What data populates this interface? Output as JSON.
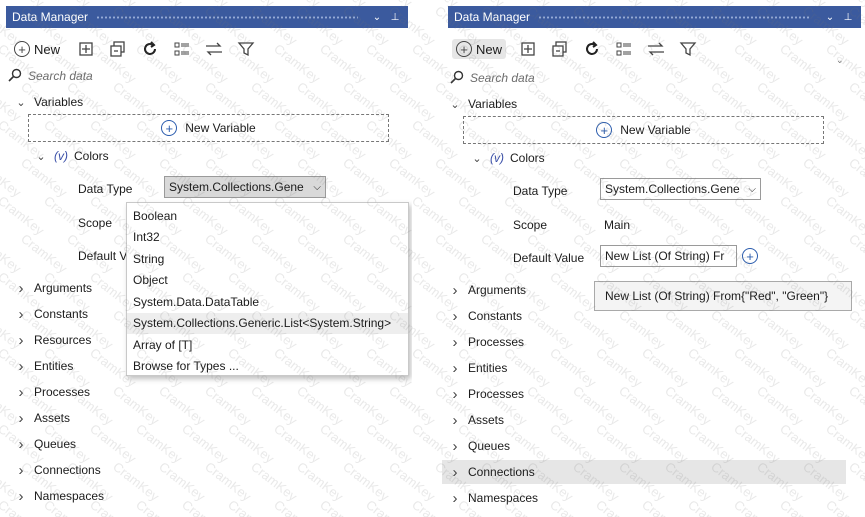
{
  "left_panel": {
    "title": "Data Manager",
    "window_buttons": [
      "⌄",
      "⊥"
    ],
    "toolbar": {
      "new_label": "New"
    },
    "search": {
      "placeholder": "Search data"
    },
    "variables_label": "Variables",
    "new_variable_label": "New Variable",
    "variable_name": "Colors",
    "variable_icon": "(v)",
    "data_type_label": "Data Type",
    "data_type_value": "System.Collections.Gene",
    "scope_label": "Scope",
    "default_label_partial": "Default V",
    "dropdown_options": [
      "Boolean",
      "Int32",
      "String",
      "Object",
      "System.Data.DataTable",
      "System.Collections.Generic.List<System.String>",
      "Array of [T]",
      "Browse for Types ..."
    ],
    "tree_items": [
      "Arguments",
      "Constants",
      "Resources",
      "Entities",
      "Processes",
      "Assets",
      "Queues",
      "Connections",
      "Namespaces"
    ]
  },
  "right_panel": {
    "title": "Data Manager",
    "window_buttons": [
      "⌄",
      "⊥"
    ],
    "toolbar": {
      "new_label": "New"
    },
    "search": {
      "placeholder": "Search data"
    },
    "variables_label": "Variables",
    "new_variable_label": "New Variable",
    "variable_name": "Colors",
    "variable_icon": "(v)",
    "data_type_label": "Data Type",
    "data_type_value": "System.Collections.Gene",
    "scope_label": "Scope",
    "scope_value": "Main",
    "default_label": "Default Value",
    "default_value": "New List (Of String) Fr",
    "tooltip": "New List (Of String) From{\"Red\", \"Green\"}",
    "tree_items": [
      "Arguments",
      "Constants",
      "Processes",
      "Entities",
      "Processes",
      "Assets",
      "Queues",
      "Connections",
      "Namespaces"
    ]
  },
  "watermark_text": "CramKey"
}
